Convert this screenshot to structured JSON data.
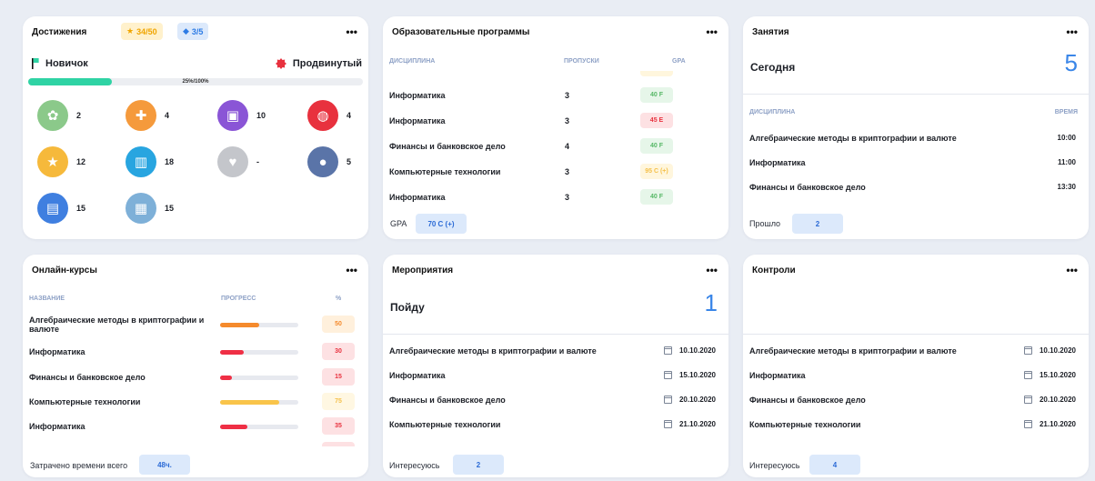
{
  "achievements": {
    "title": "Достижения",
    "stars": "34/50",
    "gems": "3/5",
    "level_from": "Новичок",
    "level_to": "Продвинутый",
    "progress_text": "25%/100%",
    "progress_fraction": 0.25,
    "items": [
      {
        "icon": "award-ribbon-icon",
        "color": "#8bc98a",
        "count": "2"
      },
      {
        "icon": "puzzle-icon",
        "color": "#f59a3c",
        "count": "4"
      },
      {
        "icon": "notebook-icon",
        "color": "#8a55d6",
        "count": "10"
      },
      {
        "icon": "basketball-icon",
        "color": "#e8313e",
        "count": "4"
      },
      {
        "icon": "shield-star-icon",
        "color": "#f6b93b",
        "count": "12"
      },
      {
        "icon": "books-icon",
        "color": "#28a5e0",
        "count": "18"
      },
      {
        "icon": "heart-hand-icon",
        "color": "#c4c6cb",
        "count": "-"
      },
      {
        "icon": "group-icon",
        "color": "#5a74a8",
        "count": "5"
      },
      {
        "icon": "newspaper-icon",
        "color": "#3f7fe0",
        "count": "15"
      },
      {
        "icon": "presentation-icon",
        "color": "#7eb0d8",
        "count": "15"
      }
    ]
  },
  "programs": {
    "title": "Образовательные программы",
    "col_discipline": "ДИСЦИПЛИНА",
    "col_absences": "ПРОПУСКИ",
    "col_gpa": "GPA",
    "rows": [
      {
        "name": "Информатика",
        "absences": "3",
        "gpa": "40 F",
        "bg": "#e6f6e9",
        "fg": "#57b867"
      },
      {
        "name": "Информатика",
        "absences": "3",
        "gpa": "45 E",
        "bg": "#fde1e3",
        "fg": "#e8313e"
      },
      {
        "name": "Финансы и банковское дело",
        "absences": "4",
        "gpa": "40 F",
        "bg": "#e6f6e9",
        "fg": "#57b867"
      },
      {
        "name": "Компьютерные технологии",
        "absences": "3",
        "gpa": "95 C (+)",
        "bg": "#fff6dd",
        "fg": "#f5c04a"
      },
      {
        "name": "Информатика",
        "absences": "3",
        "gpa": "40 F",
        "bg": "#e6f6e9",
        "fg": "#57b867"
      }
    ],
    "footer_label": "GPA",
    "footer_value": "70 C (+)"
  },
  "classes": {
    "title": "Занятия",
    "today_label": "Сегодня",
    "today_count": "5",
    "col_discipline": "ДИСЦИПЛИНА",
    "col_time": "ВРЕМЯ",
    "rows": [
      {
        "name": "Алгебраические методы в криптографии и валюте",
        "time": "10:00"
      },
      {
        "name": "Информатика",
        "time": "11:00"
      },
      {
        "name": "Финансы и банковское дело",
        "time": "13:30"
      }
    ],
    "footer_label": "Прошло",
    "footer_value": "2"
  },
  "courses": {
    "title": "Онлайн-курсы",
    "col_name": "НАЗВАНИЕ",
    "col_progress": "ПРОГРЕСС",
    "col_percent": "%",
    "rows": [
      {
        "name": "Алгебраические методы в криптографии и валюте",
        "percent": "50",
        "value": 0.5,
        "bar": "#f58a2c",
        "bg": "#fff0dc",
        "fg": "#f58a2c"
      },
      {
        "name": "Информатика",
        "percent": "30",
        "value": 0.3,
        "bar": "#ef2f45",
        "bg": "#fde1e3",
        "fg": "#e8313e"
      },
      {
        "name": "Финансы и банковское дело",
        "percent": "15",
        "value": 0.15,
        "bar": "#ef2f45",
        "bg": "#fde1e3",
        "fg": "#e8313e"
      },
      {
        "name": "Компьютерные технологии",
        "percent": "75",
        "value": 0.75,
        "bar": "#f9c44a",
        "bg": "#fff7e2",
        "fg": "#f5c04a"
      },
      {
        "name": "Информатика",
        "percent": "35",
        "value": 0.35,
        "bar": "#ef2f45",
        "bg": "#fde1e3",
        "fg": "#e8313e"
      }
    ],
    "footer_label": "Затрачено времени всего",
    "footer_value": "48ч."
  },
  "events": {
    "title": "Мероприятия",
    "going_label": "Пойду",
    "going_count": "1",
    "rows": [
      {
        "name": "Алгебраические методы в криптографии и валюте",
        "date": "10.10.2020"
      },
      {
        "name": "Информатика",
        "date": "15.10.2020"
      },
      {
        "name": "Финансы и банковское дело",
        "date": "20.10.2020"
      },
      {
        "name": "Компьютерные технологии",
        "date": "21.10.2020"
      }
    ],
    "footer_label": "Интересуюсь",
    "footer_value": "2"
  },
  "controls": {
    "title": "Контроли",
    "rows": [
      {
        "name": "Алгебраические методы в криптографии и валюте",
        "date": "10.10.2020"
      },
      {
        "name": "Информатика",
        "date": "15.10.2020"
      },
      {
        "name": "Финансы и банковское дело",
        "date": "20.10.2020"
      },
      {
        "name": "Компьютерные технологии",
        "date": "21.10.2020"
      }
    ],
    "footer_label": "Интересуюсь",
    "footer_value": "4"
  },
  "menu_glyph": "•••"
}
